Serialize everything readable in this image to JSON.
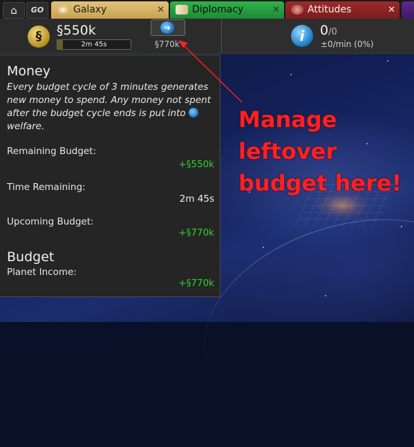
{
  "tabs": {
    "home_icon": "home-icon",
    "go_label": "GO",
    "items": [
      {
        "label": "Galaxy",
        "icon": "galaxy-icon",
        "close": "✕"
      },
      {
        "label": "Diplomacy",
        "icon": "scroll-icon",
        "close": "✕"
      },
      {
        "label": "Attitudes",
        "icon": "people-icon",
        "close": "✕"
      }
    ]
  },
  "money": {
    "symbol": "§",
    "amount": "§550k",
    "timer": "2m 45s",
    "timer_progress": 0.08,
    "welfare_amount": "§770k"
  },
  "influence": {
    "value": "0",
    "max": "/0",
    "rate": "±0/min (0%)"
  },
  "panel": {
    "title": "Money",
    "description": "Every budget cycle of 3 minutes generates new money to spend. Any money not spent after the budget cycle ends is put into",
    "description_end": "welfare.",
    "remaining_budget_label": "Remaining Budget:",
    "remaining_budget_value": "+§550k",
    "time_remaining_label": "Time Remaining:",
    "time_remaining_value": "2m 45s",
    "upcoming_budget_label": "Upcoming Budget:",
    "upcoming_budget_value": "+§770k",
    "budget_title": "Budget",
    "planet_income_label": "Planet Income:",
    "planet_income_value": "+§770k"
  },
  "annotation": {
    "line1": "Manage",
    "line2": "leftover",
    "line3": "budget here!",
    "color": "#ff2020"
  }
}
